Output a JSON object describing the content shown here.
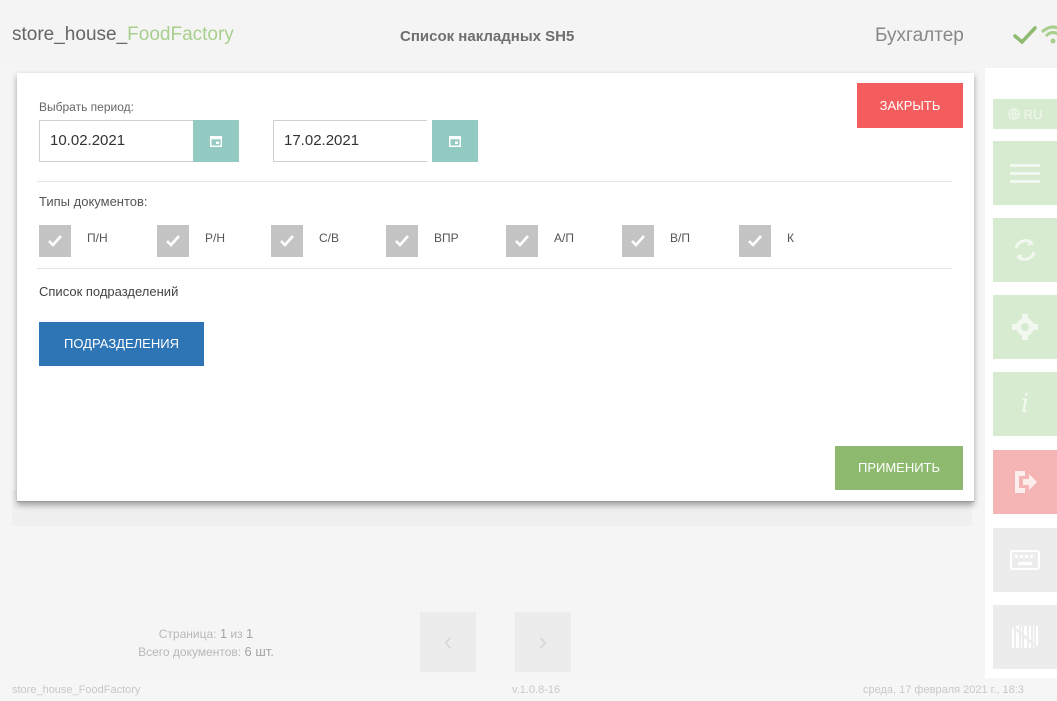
{
  "header": {
    "app_prefix": "store_house_",
    "app_accent": "FoodFactory",
    "page_title": "Список накладных SH5",
    "user_role": "Бухгалтер"
  },
  "rail": {
    "lang_label": "RU",
    "items": [
      "menu-icon",
      "sync-icon",
      "settings-icon",
      "info-icon",
      "logout-icon",
      "keyboard-icon",
      "barcode-icon"
    ]
  },
  "pager": {
    "page_label": "Страница:",
    "page_current": "1",
    "page_of": "из",
    "page_total": "1",
    "docs_label": "Всего документов:",
    "docs_count": "6 шт.",
    "prev": "‹",
    "next": "›"
  },
  "footer": {
    "left": "store_house_FoodFactory",
    "version": "v.1.0.8-16",
    "datetime": "среда, 17 февраля 2021 г., 18:3"
  },
  "modal": {
    "period_label": "Выбрать период:",
    "date_from": "10.02.2021",
    "date_to": "17.02.2021",
    "close_label": "ЗАКРЫТЬ",
    "doc_types_label": "Типы документов:",
    "doc_types": [
      {
        "label": "П/Н",
        "checked": true
      },
      {
        "label": "Р/Н",
        "checked": true
      },
      {
        "label": "С/В",
        "checked": true
      },
      {
        "label": "ВПР",
        "checked": true
      },
      {
        "label": "А/П",
        "checked": true
      },
      {
        "label": "В/П",
        "checked": true
      },
      {
        "label": "К",
        "checked": true
      }
    ],
    "subdivisions_label": "Список подразделений",
    "subdivisions_button": "ПОДРАЗДЕЛЕНИЯ",
    "apply_label": "ПРИМЕНИТЬ"
  },
  "colors": {
    "accent_green": "#a9cf8d",
    "close_red": "#f45d5d",
    "apply_green": "#8dba6e",
    "primary_blue": "#2e75b6",
    "calendar_teal": "#93cac1"
  }
}
